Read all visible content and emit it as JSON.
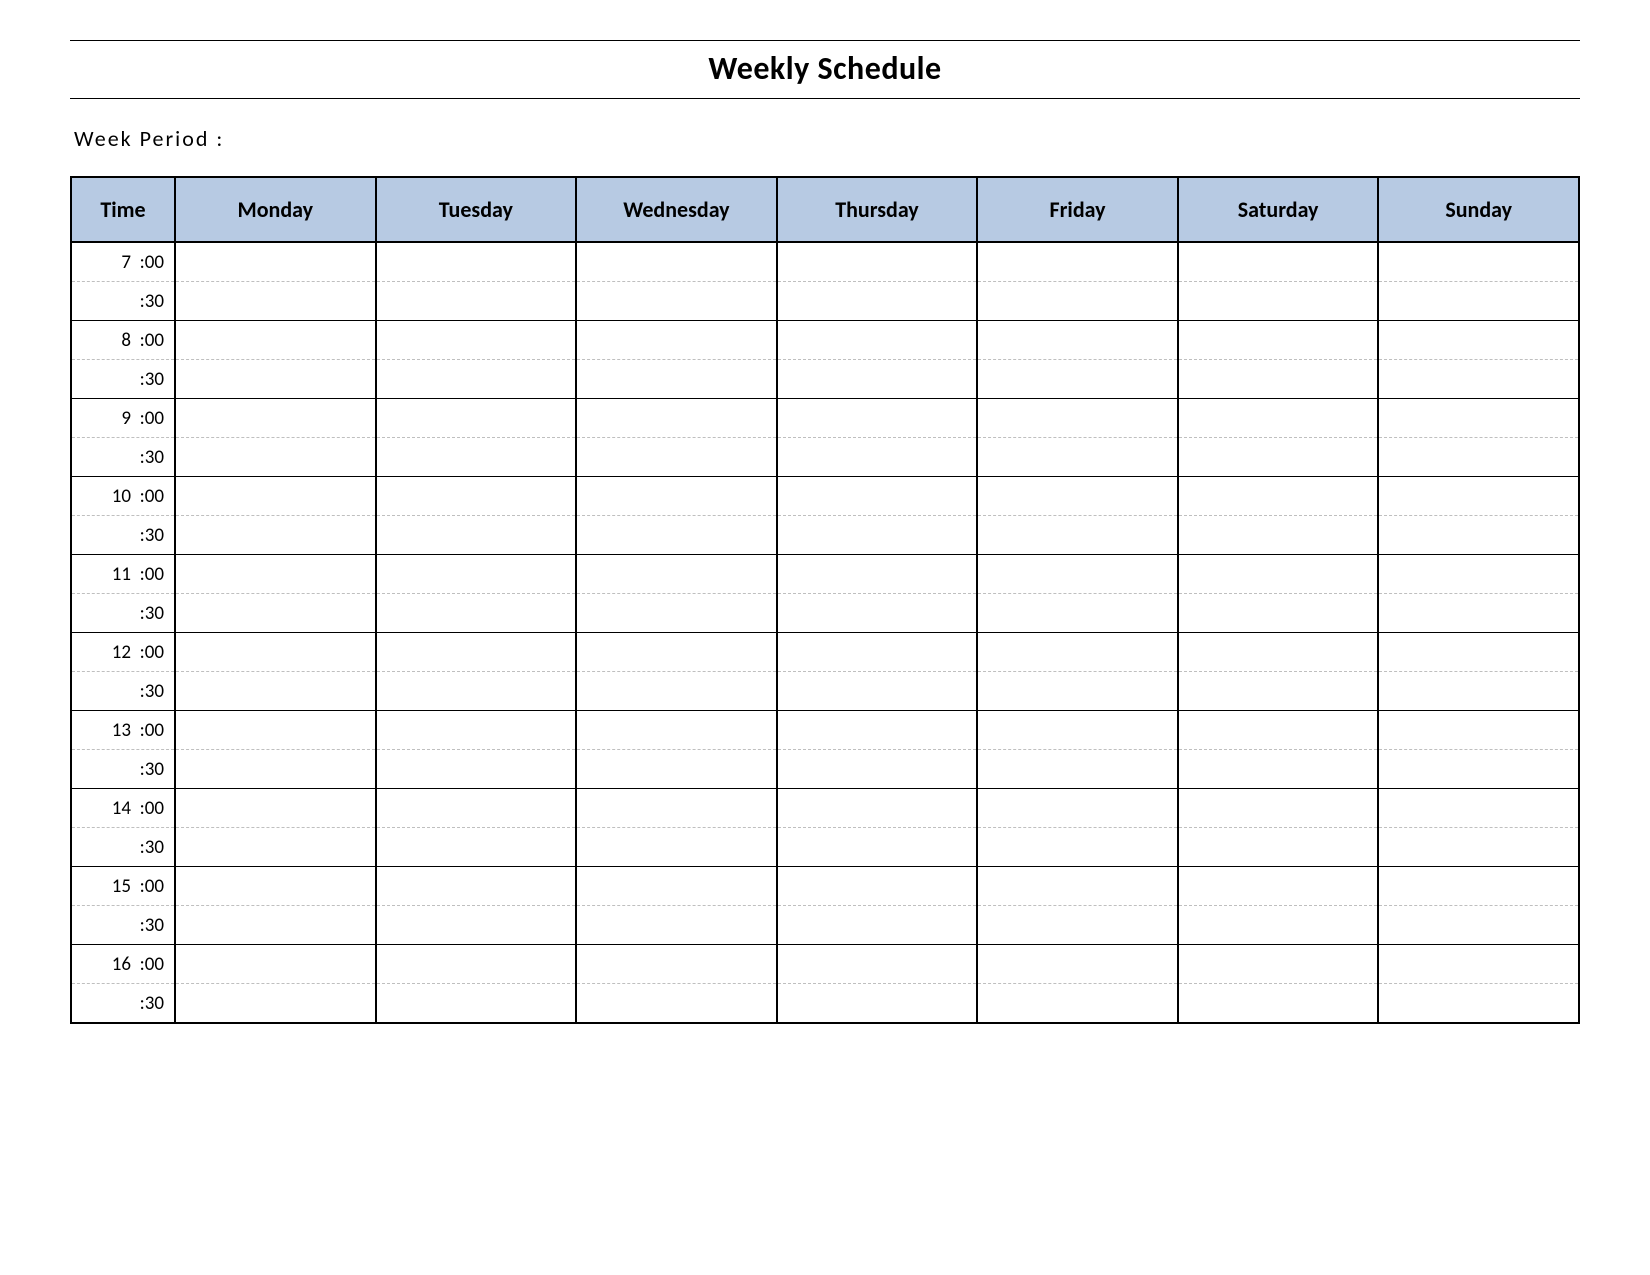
{
  "title": "Weekly Schedule",
  "week_period_label": "Week  Period :",
  "columns": [
    "Time",
    "Monday",
    "Tuesday",
    "Wednesday",
    "Thursday",
    "Friday",
    "Saturday",
    "Sunday"
  ],
  "time_slots": [
    "7  :00",
    ":30",
    "8  :00",
    ":30",
    "9  :00",
    ":30",
    "10  :00",
    ":30",
    "11  :00",
    ":30",
    "12  :00",
    ":30",
    "13  :00",
    ":30",
    "14  :00",
    ":30",
    "15  :00",
    ":30",
    "16  :00",
    ":30"
  ]
}
